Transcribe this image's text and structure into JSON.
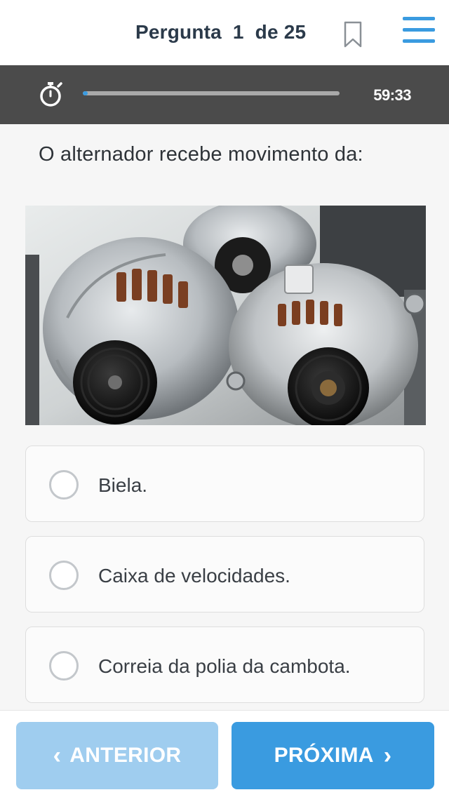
{
  "header": {
    "title": "Pergunta  1  de 25",
    "bookmark_icon": "bookmark-icon",
    "menu_icon": "hamburger-menu-icon",
    "accent_color": "#3a9be0"
  },
  "timer": {
    "icon": "stopwatch-icon",
    "remaining": "59:33",
    "progress_fraction": 0.02
  },
  "question": {
    "text": "O alternador recebe movimento da:",
    "image": "photo of car alternators"
  },
  "options": [
    {
      "label": "Biela.",
      "selected": false
    },
    {
      "label": "Caixa de velocidades.",
      "selected": false
    },
    {
      "label": "Correia da polia da cambota.",
      "selected": false
    }
  ],
  "navigation": {
    "previous_label": "ANTERIOR",
    "next_label": "PRÓXIMA",
    "previous_color": "#9fcdef",
    "next_color": "#3a9be0"
  }
}
